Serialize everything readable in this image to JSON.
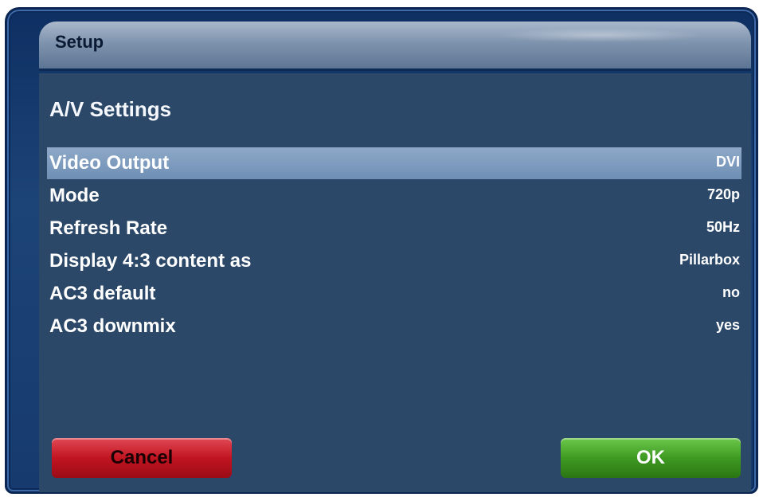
{
  "window": {
    "title": "Setup"
  },
  "section": {
    "title": "A/V Settings"
  },
  "settings": [
    {
      "label": "Video Output",
      "value": "DVI",
      "selected": true
    },
    {
      "label": "Mode",
      "value": "720p",
      "selected": false
    },
    {
      "label": "Refresh Rate",
      "value": "50Hz",
      "selected": false
    },
    {
      "label": "Display 4:3 content as",
      "value": "Pillarbox",
      "selected": false
    },
    {
      "label": "AC3 default",
      "value": "no",
      "selected": false
    },
    {
      "label": "AC3 downmix",
      "value": "yes",
      "selected": false
    }
  ],
  "buttons": {
    "cancel_label": "Cancel",
    "ok_label": "OK"
  },
  "colors": {
    "selected_row": "#7f9cc0",
    "cancel": "#c21421",
    "ok": "#3f9a22",
    "panel": "#2c4868"
  }
}
